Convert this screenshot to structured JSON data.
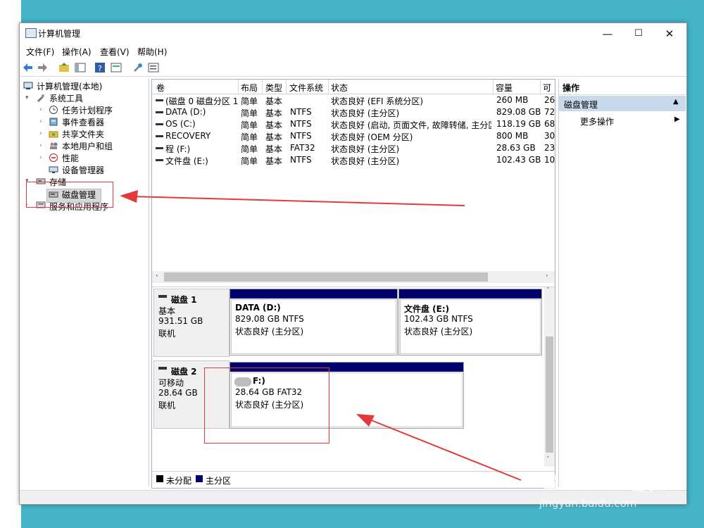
{
  "window": {
    "title": "计算机管理",
    "controls": {
      "minimize": "—",
      "maximize": "☐",
      "close": "✕"
    }
  },
  "menu": [
    "文件(F)",
    "操作(A)",
    "查看(V)",
    "帮助(H)"
  ],
  "tree": {
    "root": "计算机管理(本地)",
    "system_tools": "系统工具",
    "children": [
      "任务计划程序",
      "事件查看器",
      "共享文件夹",
      "本地用户和组",
      "性能",
      "设备管理器"
    ],
    "storage": "存储",
    "disk_management": "磁盘管理",
    "services": "服务和应用程序"
  },
  "volume_table": {
    "headers": [
      "卷",
      "布局",
      "类型",
      "文件系统",
      "状态",
      "容量",
      "可"
    ],
    "rows": [
      [
        "(磁盘 0 磁盘分区 1)",
        "简单",
        "基本",
        "",
        "状态良好 (EFI 系统分区)",
        "260 MB",
        "26"
      ],
      [
        "DATA (D:)",
        "简单",
        "基本",
        "NTFS",
        "状态良好 (主分区)",
        "829.08 GB",
        "72"
      ],
      [
        "OS (C:)",
        "简单",
        "基本",
        "NTFS",
        "状态良好 (启动, 页面文件, 故障转储, 主分区)",
        "118.19 GB",
        "68"
      ],
      [
        "RECOVERY",
        "简单",
        "基本",
        "NTFS",
        "状态良好 (OEM 分区)",
        "800 MB",
        "30"
      ],
      [
        "程 (F:)",
        "简单",
        "基本",
        "FAT32",
        "状态良好 (主分区)",
        "28.63 GB",
        "23"
      ],
      [
        "文件盘 (E:)",
        "简单",
        "基本",
        "NTFS",
        "状态良好 (主分区)",
        "102.43 GB",
        "10"
      ]
    ]
  },
  "disks": [
    {
      "name": "磁盘 1",
      "type": "基本",
      "size": "931.51 GB",
      "status": "联机",
      "partitions": [
        {
          "name": "DATA  (D:)",
          "size": "829.08 GB NTFS",
          "status": "状态良好 (主分区)"
        },
        {
          "name": "文件盘  (E:)",
          "size": "102.43 GB NTFS",
          "status": "状态良好 (主分区)"
        }
      ]
    },
    {
      "name": "磁盘 2",
      "type": "可移动",
      "size": "28.64 GB",
      "status": "联机",
      "partitions": [
        {
          "name": "F:)",
          "size": "28.64 GB FAT32",
          "status": "状态良好 (主分区)"
        }
      ]
    }
  ],
  "legend": [
    {
      "label": "未分配",
      "color": "#000000"
    },
    {
      "label": "主分区",
      "color": "#00006e"
    }
  ],
  "actions": {
    "header": "操作",
    "section": "磁盘管理",
    "more": "更多操作"
  },
  "watermark": {
    "brand": "Bai du 经验",
    "url": "jingyan.baidu.com"
  },
  "colors": {
    "primary_partition": "#00006e",
    "annotation": "#e23a3a",
    "background": "#45b3c8"
  }
}
